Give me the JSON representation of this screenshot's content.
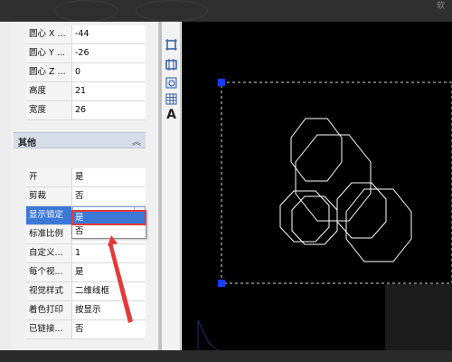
{
  "background_app": {
    "corner_text": "软"
  },
  "properties_panel": {
    "geometry_rows": [
      {
        "label": "圆心 X ...",
        "value": "-44"
      },
      {
        "label": "圆心 Y ...",
        "value": "-26"
      },
      {
        "label": "圆心 Z ...",
        "value": "0"
      },
      {
        "label": "高度",
        "value": "21"
      },
      {
        "label": "宽度",
        "value": "26"
      }
    ],
    "section_title": "其他",
    "other_rows": [
      {
        "label": "开",
        "value": "是"
      },
      {
        "label": "剪裁",
        "value": "否"
      },
      {
        "label": "显示锁定",
        "value": "是"
      },
      {
        "label": "标准比例",
        "value": ""
      },
      {
        "label": "自定义...",
        "value": "1"
      },
      {
        "label": "每个视...",
        "value": "是"
      },
      {
        "label": "视觉样式",
        "value": "二维线框"
      },
      {
        "label": "着色打印",
        "value": "按显示"
      },
      {
        "label": "已链接...",
        "value": "否"
      }
    ],
    "dropdown_options": [
      "是",
      "否"
    ],
    "dropdown_selected": "是"
  },
  "toolbar": {
    "icons": [
      "layout-icon",
      "viewport-icon",
      "shape-icon",
      "table-icon",
      "text-icon"
    ],
    "text_tool_label": "A"
  },
  "colors": {
    "canvas": "#000000",
    "selection_grip": "#1a3cff",
    "annotation": "#e23a3a",
    "row_highlight": "#3c78d8"
  }
}
